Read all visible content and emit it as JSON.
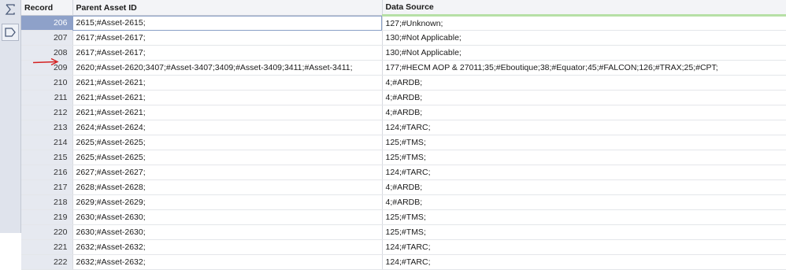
{
  "columns": {
    "record": "Record",
    "parent_asset_id": "Parent Asset ID",
    "data_source": "Data Source"
  },
  "icons": {
    "top": "sigma-icon",
    "second": "tag-shape-icon"
  },
  "accent_colors": {
    "selected_record": "#8ea1c9",
    "header_underline": "#b6e0a6",
    "annotation_arrow": "#d42020"
  },
  "rows": [
    {
      "record": "206",
      "parent_asset_id": "2615;#Asset-2615;",
      "data_source": "127;#Unknown;"
    },
    {
      "record": "207",
      "parent_asset_id": "2617;#Asset-2617;",
      "data_source": "130;#Not Applicable;"
    },
    {
      "record": "208",
      "parent_asset_id": "2617;#Asset-2617;",
      "data_source": "130;#Not Applicable;"
    },
    {
      "record": "209",
      "parent_asset_id": "2620;#Asset-2620;3407;#Asset-3407;3409;#Asset-3409;3411;#Asset-3411;",
      "data_source": "177;#HECM AOP & 27011;35;#Eboutique;38;#Equator;45;#FALCON;126;#TRAX;25;#CPT;"
    },
    {
      "record": "210",
      "parent_asset_id": "2621;#Asset-2621;",
      "data_source": "4;#ARDB;"
    },
    {
      "record": "211",
      "parent_asset_id": "2621;#Asset-2621;",
      "data_source": "4;#ARDB;"
    },
    {
      "record": "212",
      "parent_asset_id": "2621;#Asset-2621;",
      "data_source": "4;#ARDB;"
    },
    {
      "record": "213",
      "parent_asset_id": "2624;#Asset-2624;",
      "data_source": "124;#TARC;"
    },
    {
      "record": "214",
      "parent_asset_id": "2625;#Asset-2625;",
      "data_source": "125;#TMS;"
    },
    {
      "record": "215",
      "parent_asset_id": "2625;#Asset-2625;",
      "data_source": "125;#TMS;"
    },
    {
      "record": "216",
      "parent_asset_id": "2627;#Asset-2627;",
      "data_source": "124;#TARC;"
    },
    {
      "record": "217",
      "parent_asset_id": "2628;#Asset-2628;",
      "data_source": "4;#ARDB;"
    },
    {
      "record": "218",
      "parent_asset_id": "2629;#Asset-2629;",
      "data_source": "4;#ARDB;"
    },
    {
      "record": "219",
      "parent_asset_id": "2630;#Asset-2630;",
      "data_source": "125;#TMS;"
    },
    {
      "record": "220",
      "parent_asset_id": "2630;#Asset-2630;",
      "data_source": "125;#TMS;"
    },
    {
      "record": "221",
      "parent_asset_id": "2632;#Asset-2632;",
      "data_source": "124;#TARC;"
    },
    {
      "record": "222",
      "parent_asset_id": "2632;#Asset-2632;",
      "data_source": "124;#TARC;"
    }
  ]
}
